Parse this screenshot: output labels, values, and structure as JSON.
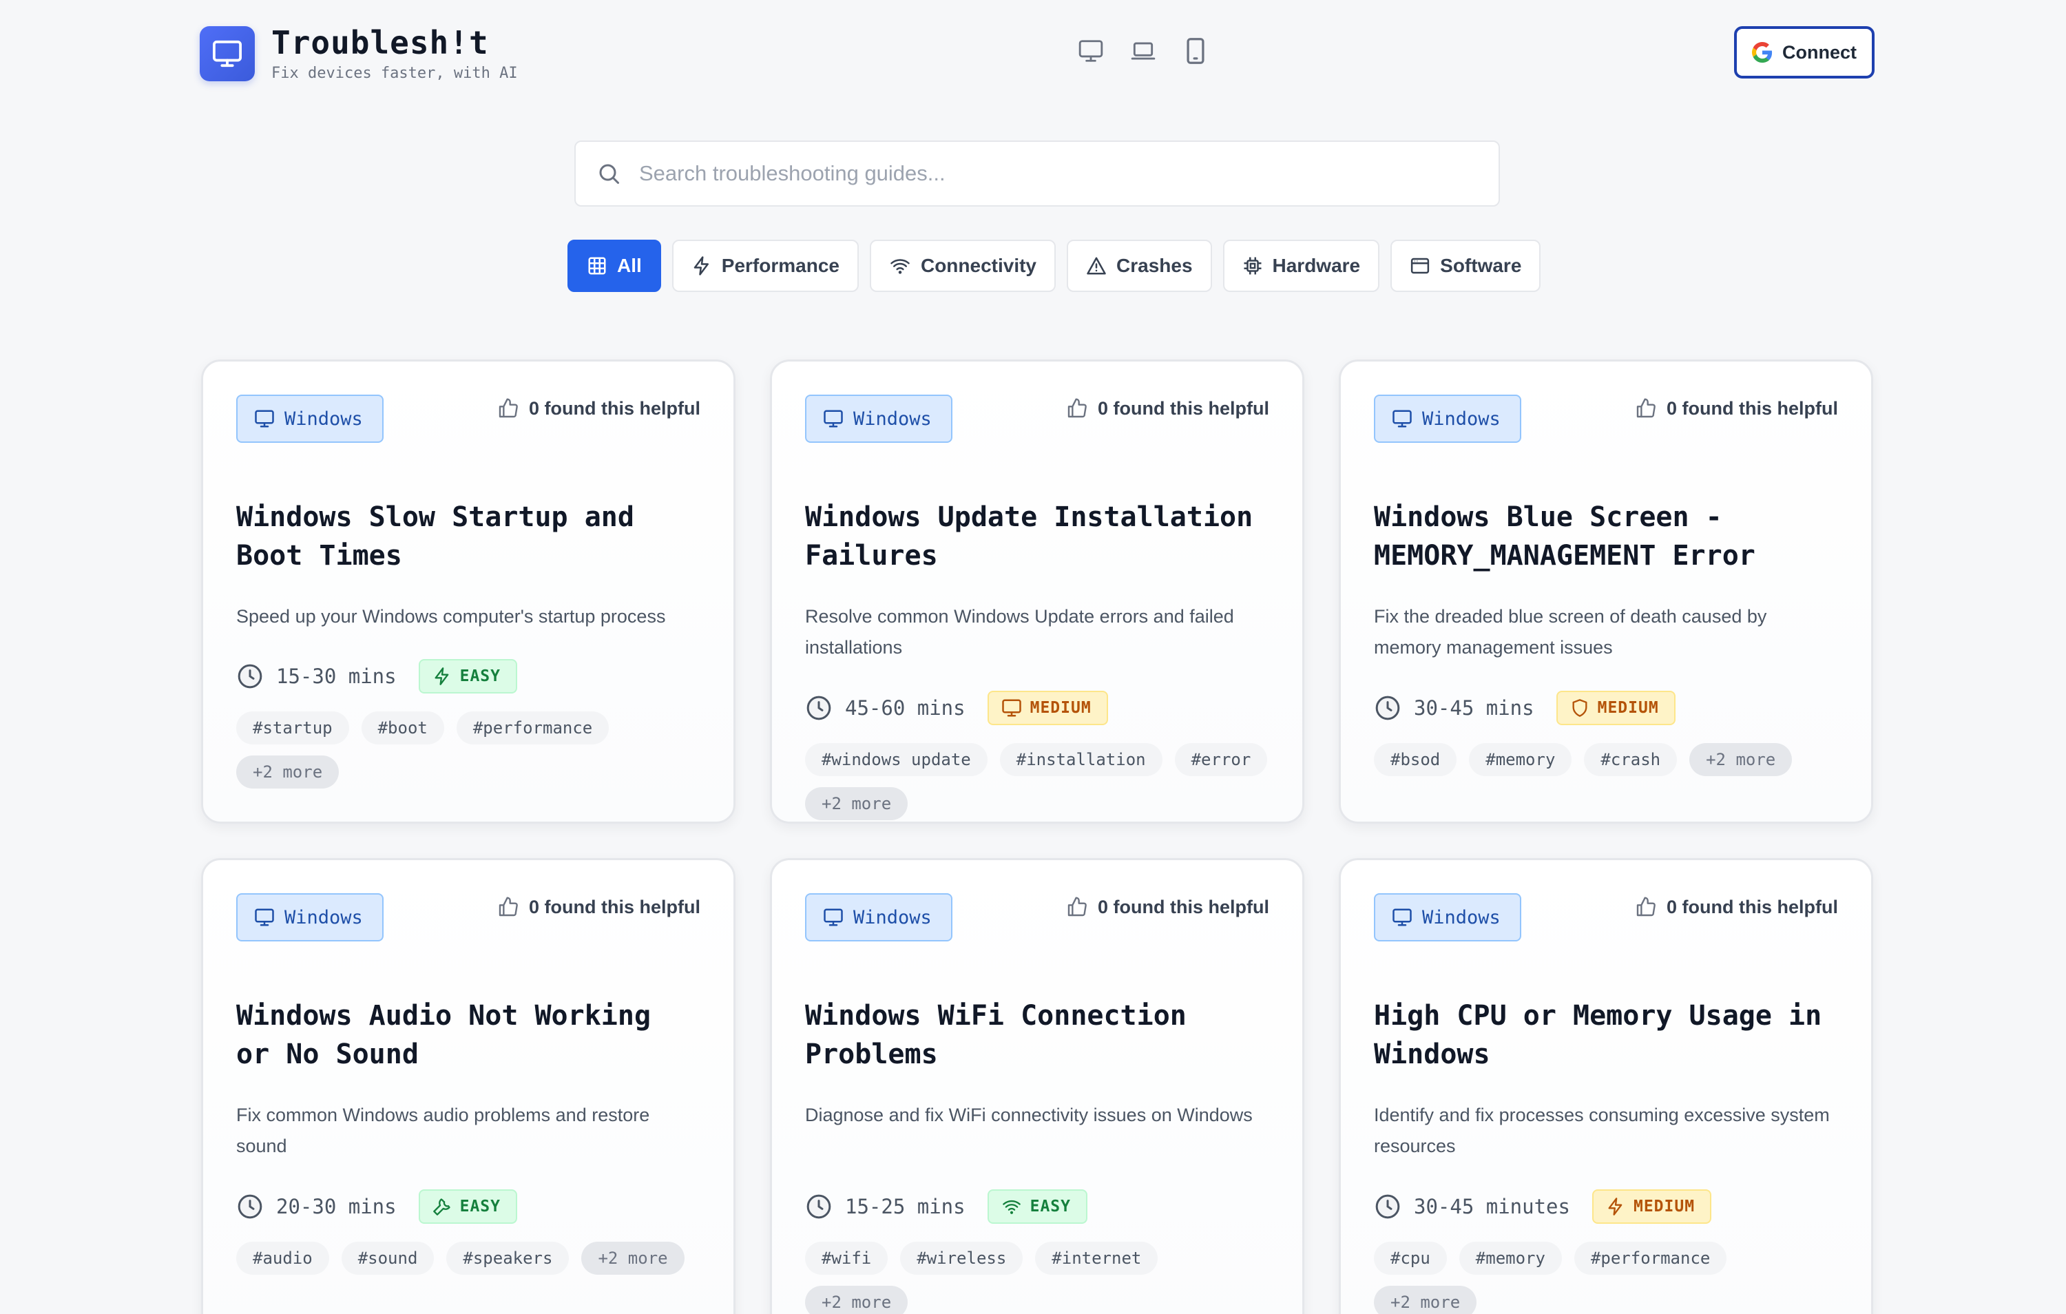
{
  "app": {
    "title": "Troublesh!t",
    "subtitle": "Fix devices faster, with AI"
  },
  "header": {
    "device_icons": [
      "desktop-icon",
      "laptop-icon",
      "tablet-icon"
    ],
    "connect_label": "Connect"
  },
  "search": {
    "placeholder": "Search troubleshooting guides...",
    "value": ""
  },
  "filters": [
    {
      "label": "All",
      "icon": "grid-icon",
      "active": true
    },
    {
      "label": "Performance",
      "icon": "bolt-icon",
      "active": false
    },
    {
      "label": "Connectivity",
      "icon": "wifi-icon",
      "active": false
    },
    {
      "label": "Crashes",
      "icon": "warning-icon",
      "active": false
    },
    {
      "label": "Hardware",
      "icon": "chip-icon",
      "active": false
    },
    {
      "label": "Software",
      "icon": "window-icon",
      "active": false
    }
  ],
  "cards": [
    {
      "os": "Windows",
      "helpful": "0 found this helpful",
      "title": "Windows Slow Startup and Boot Times",
      "description": "Speed up your Windows computer's startup process",
      "time": "15-30 mins",
      "difficulty": "EASY",
      "difficulty_icon": "bolt-icon",
      "tags": [
        "#startup",
        "#boot",
        "#performance"
      ],
      "more": "+2 more"
    },
    {
      "os": "Windows",
      "helpful": "0 found this helpful",
      "title": "Windows Update Installation Failures",
      "description": "Resolve common Windows Update errors and failed installations",
      "time": "45-60 mins",
      "difficulty": "MEDIUM",
      "difficulty_icon": "monitor-icon",
      "tags": [
        "#windows update",
        "#installation",
        "#error"
      ],
      "more": "+2 more"
    },
    {
      "os": "Windows",
      "helpful": "0 found this helpful",
      "title": "Windows Blue Screen - MEMORY_MANAGEMENT Error",
      "description": "Fix the dreaded blue screen of death caused by memory management issues",
      "time": "30-45 mins",
      "difficulty": "MEDIUM",
      "difficulty_icon": "shield-icon",
      "tags": [
        "#bsod",
        "#memory",
        "#crash"
      ],
      "more": "+2 more"
    },
    {
      "os": "Windows",
      "helpful": "0 found this helpful",
      "title": "Windows Audio Not Working or No Sound",
      "description": "Fix common Windows audio problems and restore sound",
      "time": "20-30 mins",
      "difficulty": "EASY",
      "difficulty_icon": "wrench-icon",
      "tags": [
        "#audio",
        "#sound",
        "#speakers"
      ],
      "more": "+2 more"
    },
    {
      "os": "Windows",
      "helpful": "0 found this helpful",
      "title": "Windows WiFi Connection Problems",
      "description": "Diagnose and fix WiFi connectivity issues on Windows",
      "time": "15-25 mins",
      "difficulty": "EASY",
      "difficulty_icon": "wifi-icon",
      "tags": [
        "#wifi",
        "#wireless",
        "#internet"
      ],
      "more": "+2 more"
    },
    {
      "os": "Windows",
      "helpful": "0 found this helpful",
      "title": "High CPU or Memory Usage in Windows",
      "description": "Identify and fix processes consuming excessive system resources",
      "time": "30-45 minutes",
      "difficulty": "MEDIUM",
      "difficulty_icon": "bolt-icon",
      "tags": [
        "#cpu",
        "#memory",
        "#performance"
      ],
      "more": "+2 more"
    }
  ],
  "colors": {
    "accent": "#2563eb",
    "easy": "#15803d",
    "medium": "#b45309",
    "os_badge": "#dbeafe"
  }
}
